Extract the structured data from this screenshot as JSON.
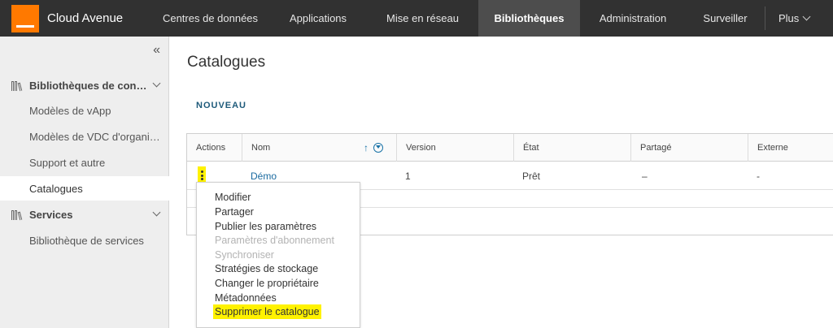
{
  "brand": {
    "name": "Cloud Avenue",
    "accent": "#ff7900"
  },
  "nav": {
    "items": [
      {
        "label": "Centres de données",
        "active": false
      },
      {
        "label": "Applications",
        "active": false
      },
      {
        "label": "Mise en réseau",
        "active": false
      },
      {
        "label": "Bibliothèques",
        "active": true
      },
      {
        "label": "Administration",
        "active": false
      },
      {
        "label": "Surveiller",
        "active": false
      }
    ],
    "more": "Plus"
  },
  "sidebar": {
    "collapse_icon": "«",
    "group1": {
      "label": "Bibliothèques de con…"
    },
    "group1_items": [
      {
        "label": "Modèles de vApp"
      },
      {
        "label": "Modèles de VDC d'organi…"
      },
      {
        "label": "Support et autre"
      },
      {
        "label": "Catalogues",
        "active": true
      }
    ],
    "group2": {
      "label": "Services"
    },
    "group2_items": [
      {
        "label": "Bibliothèque de services"
      }
    ]
  },
  "main": {
    "title": "Catalogues",
    "new_button": "NOUVEAU",
    "columns": {
      "actions": "Actions",
      "nom": "Nom",
      "version": "Version",
      "etat": "État",
      "partage": "Partagé",
      "externe": "Externe"
    },
    "rows": [
      {
        "nom": "Démo",
        "version": "1",
        "etat": "Prêt",
        "partage": "–",
        "externe": "-"
      }
    ],
    "sort_icon": "↑"
  },
  "menu": {
    "items": [
      {
        "label": "Modifier",
        "disabled": false
      },
      {
        "label": "Partager",
        "disabled": false
      },
      {
        "label": "Publier les paramètres",
        "disabled": false
      },
      {
        "label": "Paramètres d'abonnement",
        "disabled": true
      },
      {
        "label": "Synchroniser",
        "disabled": true
      },
      {
        "label": "Stratégies de stockage",
        "disabled": false
      },
      {
        "label": "Changer le propriétaire",
        "disabled": false
      },
      {
        "label": "Métadonnées",
        "disabled": false
      },
      {
        "label": "Supprimer le catalogue",
        "disabled": false,
        "highlighted": true
      }
    ]
  },
  "colors": {
    "highlight": "#fff200",
    "topbar": "#313131",
    "link": "#1a6aa0"
  }
}
